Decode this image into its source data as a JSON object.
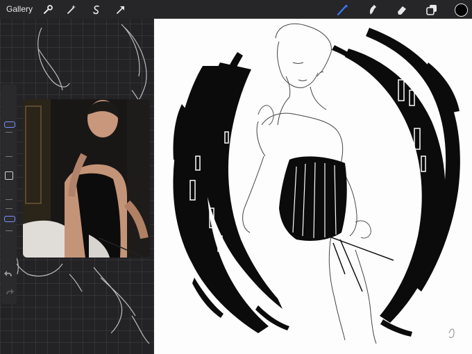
{
  "toolbar": {
    "gallery_label": "Gallery",
    "left_icons": [
      "wrench-icon",
      "magic-wand-icon",
      "selection-icon",
      "transform-arrow-icon"
    ],
    "right_icons": [
      "brush-icon",
      "smudge-icon",
      "eraser-icon",
      "layers-icon",
      "color-swatch-icon"
    ],
    "active_tool": "brush-icon",
    "accent_color": "#3a7cff",
    "current_color": "#000000"
  },
  "sidebar": {
    "brush_size_level": 0.55,
    "opacity_level": 0.35,
    "modify_icon": "square-modify-icon",
    "undo_icon": "undo-icon",
    "redo_icon": "redo-icon",
    "accent_color": "#7b8fff"
  },
  "reference": {
    "icon": "reference-photo"
  }
}
